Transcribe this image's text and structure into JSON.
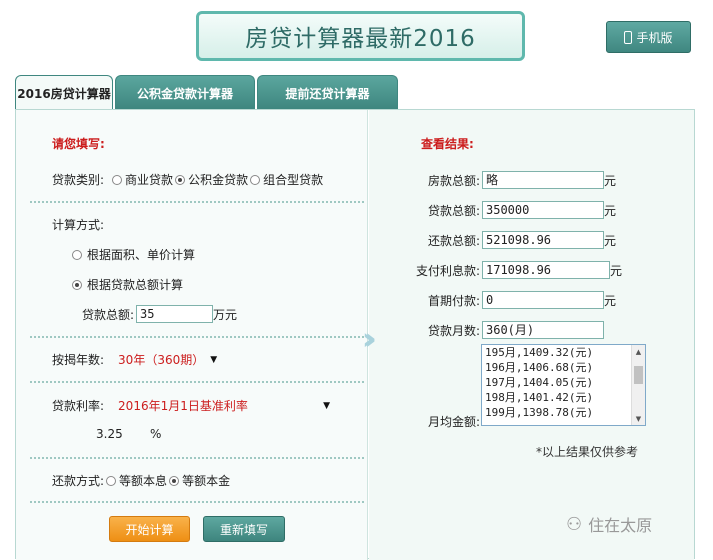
{
  "header": {
    "title": "房贷计算器最新2016",
    "mobile_button": "手机版"
  },
  "tabs": [
    {
      "label": "2016房贷计算器"
    },
    {
      "label": "公积金贷款计算器"
    },
    {
      "label": "提前还贷计算器"
    }
  ],
  "form": {
    "heading": "请您填写:",
    "loan_type_label": "贷款类别:",
    "loan_type_options": [
      "商业贷款",
      "公积金贷款",
      "组合型贷款"
    ],
    "loan_type_selected": "公积金贷款",
    "calc_method_label": "计算方式:",
    "calc_method_options": [
      "根据面积、单价计算",
      "根据贷款总额计算"
    ],
    "calc_method_selected": "根据贷款总额计算",
    "loan_total_label": "贷款总额:",
    "loan_total_value": "35",
    "loan_total_unit": "万元",
    "years_label": "按揭年数:",
    "years_value": "30年（360期）",
    "rate_label": "贷款利率:",
    "rate_value": "2016年1月1日基准利率",
    "rate_percent_value": "3.25",
    "rate_percent_unit": "%",
    "repay_label": "还款方式:",
    "repay_options": [
      "等额本息",
      "等额本金"
    ],
    "repay_selected": "等额本金",
    "calc_button": "开始计算",
    "reset_button": "重新填写"
  },
  "results": {
    "heading": "查看结果:",
    "rows": [
      {
        "label": "房款总额:",
        "value": "略",
        "unit": "元"
      },
      {
        "label": "贷款总额:",
        "value": "350000",
        "unit": "元"
      },
      {
        "label": "还款总额:",
        "value": "521098.96",
        "unit": "元"
      },
      {
        "label": "支付利息款:",
        "value": "171098.96",
        "unit": "元"
      },
      {
        "label": "首期付款:",
        "value": "0",
        "unit": "元"
      },
      {
        "label": "贷款月数:",
        "value": "360(月)",
        "unit": ""
      }
    ],
    "monthly_label": "月均金额:",
    "monthly_items": [
      "195月,1409.32(元)",
      "196月,1406.68(元)",
      "197月,1404.05(元)",
      "198月,1401.42(元)",
      "199月,1398.78(元)"
    ],
    "note": "*以上结果仅供参考"
  },
  "watermark": "住在太原"
}
